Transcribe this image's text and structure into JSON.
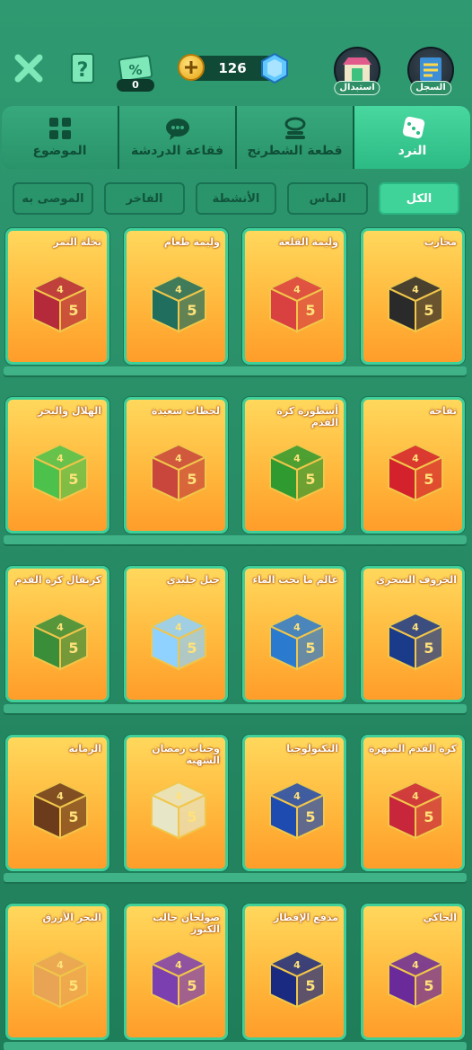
{
  "header": {
    "promo_count": "0",
    "coins": "126",
    "exchange_label": "استبدال",
    "record_label": "السجل"
  },
  "tabs": [
    {
      "label": "الموضوع",
      "icon": "grid-icon"
    },
    {
      "label": "فقاعة الدردشة",
      "icon": "chat-bubble-icon"
    },
    {
      "label": "قطعة الشطرنج",
      "icon": "chess-piece-icon"
    },
    {
      "label": "النرد",
      "icon": "dice-icon",
      "active": true
    }
  ],
  "filters": [
    {
      "label": "الكل",
      "active": true
    },
    {
      "label": "الماس"
    },
    {
      "label": "الأنشطة"
    },
    {
      "label": "الفاخر"
    },
    {
      "label": "الموصى به"
    }
  ],
  "items": [
    [
      "محارب",
      "وليمة القلعة",
      "وليمة طعام",
      "نخلة التمر"
    ],
    [
      "تفاحة",
      "أسطورة كرة القدم",
      "لحظات سعيدة",
      "الهلال والبحر"
    ],
    [
      "الخروف السحري",
      "عالم ما تحت الماء",
      "جبل جليدي",
      "كرنفال كرة القدم"
    ],
    [
      "كرة القدم المبهرة",
      "التكنولوجيا",
      "وجبات رمضان الشهية",
      "الرماية"
    ],
    [
      "الحاكي",
      "مدفع الإفطار",
      "صولجان جالب الكنوز",
      "البحر الأزرق"
    ]
  ],
  "item_colors": [
    [
      "#2a2a2a",
      "#d94040",
      "#1f6e5e",
      "#b52a3a"
    ],
    [
      "#d3222b",
      "#2f9a2f",
      "#c8463c",
      "#4cc24c"
    ],
    [
      "#1a3a8a",
      "#2a7bd0",
      "#8fd1ff",
      "#3a8e3a"
    ],
    [
      "#c8263a",
      "#1e4bb0",
      "#e7e7c8",
      "#6b3b1c"
    ],
    [
      "#6a2a9a",
      "#1a2a80",
      "#7b3fb0",
      "#e8a454"
    ]
  ]
}
